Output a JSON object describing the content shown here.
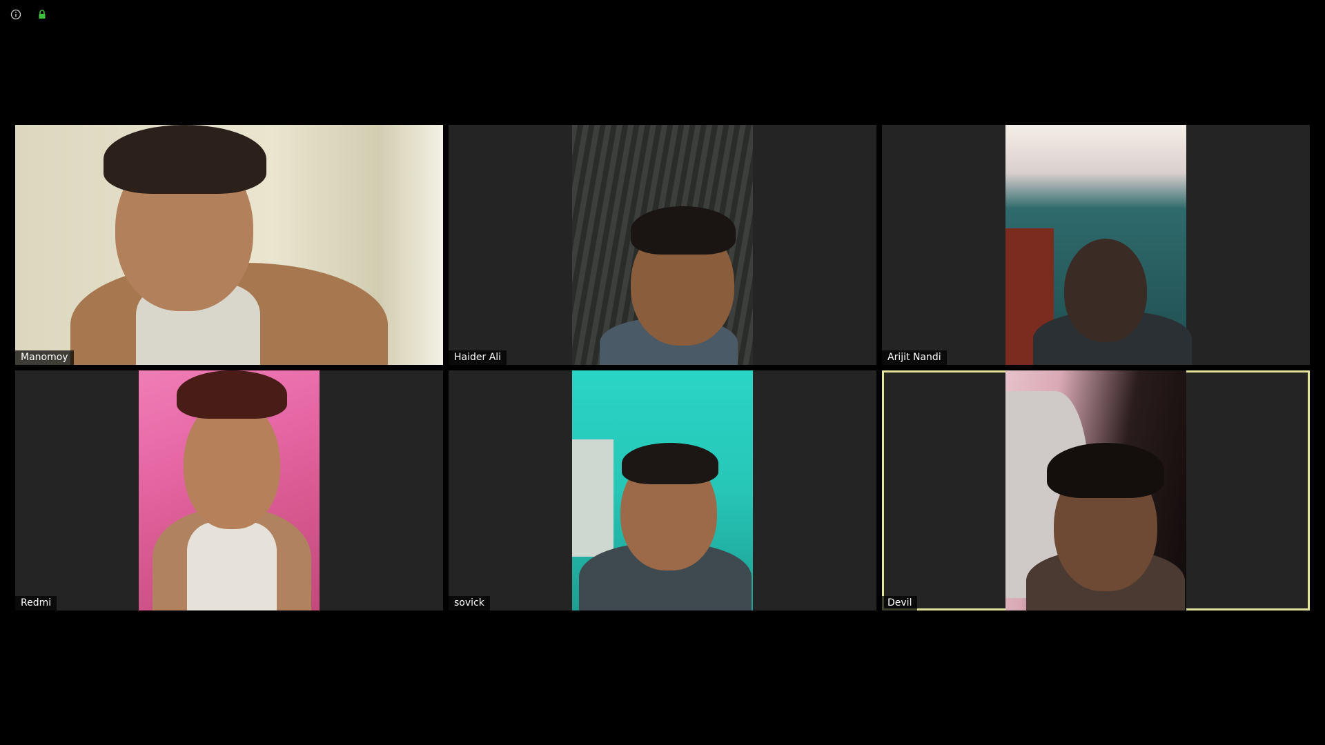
{
  "toolbar": {
    "info_icon": "info-icon",
    "lock_icon": "lock-icon",
    "lock_color": "#3cc13c"
  },
  "colors": {
    "active_speaker_border": "#e2e49a",
    "tile_background": "#242424"
  },
  "participants": [
    {
      "name": "Manomoy"
    },
    {
      "name": "Haider Ali"
    },
    {
      "name": "Arijit Nandi"
    },
    {
      "name": "Redmi"
    },
    {
      "name": "sovick"
    },
    {
      "name": "Devil"
    }
  ]
}
